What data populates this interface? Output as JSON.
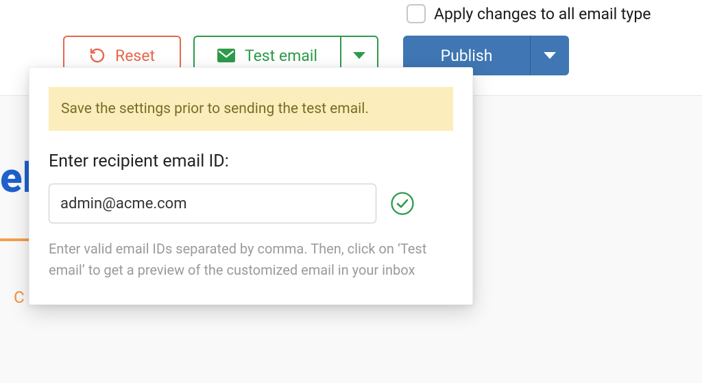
{
  "toolbar": {
    "apply_all_label": "Apply changes to all email type",
    "reset_label": "Reset",
    "test_email_label": "Test email",
    "publish_label": "Publish"
  },
  "popover": {
    "alert_text": "Save the settings prior to sending the test email.",
    "field_label": "Enter recipient email ID:",
    "email_value": "admin@acme.com",
    "hint_text": "Enter valid email IDs separated by comma. Then, click on ‘Test email’ to get a preview of the customized email in your inbox"
  },
  "colors": {
    "reset": "#e8674d",
    "test": "#2c9b4a",
    "publish": "#3f76b3",
    "alert_bg": "#fbeebc",
    "alert_text": "#7c6b26"
  }
}
